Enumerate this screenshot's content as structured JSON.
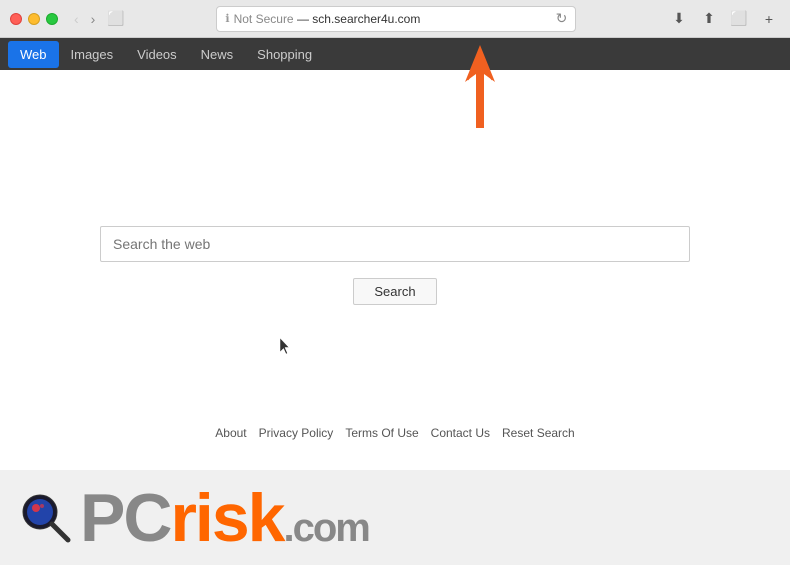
{
  "browser": {
    "title": "Not Secure — sch.searcher4u.com",
    "url_label": "Not Secure — sch.searcher4u.com",
    "not_secure_text": "Not Secure",
    "url_text": "sch.searcher4u.com"
  },
  "tabs": {
    "items": [
      {
        "label": "Web",
        "active": true
      },
      {
        "label": "Images",
        "active": false
      },
      {
        "label": "Videos",
        "active": false
      },
      {
        "label": "News",
        "active": false
      },
      {
        "label": "Shopping",
        "active": false
      }
    ]
  },
  "search": {
    "placeholder": "Search the web",
    "button_label": "Search"
  },
  "footer": {
    "links": [
      {
        "label": "About"
      },
      {
        "label": "Privacy Policy"
      },
      {
        "label": "Terms Of Use"
      },
      {
        "label": "Contact Us"
      },
      {
        "label": "Reset Search"
      }
    ]
  },
  "watermark": {
    "pc_text": "PC",
    "risk_text": "risk",
    "com_text": ".com"
  },
  "annotation": {
    "arrow_color": "#f06020"
  }
}
